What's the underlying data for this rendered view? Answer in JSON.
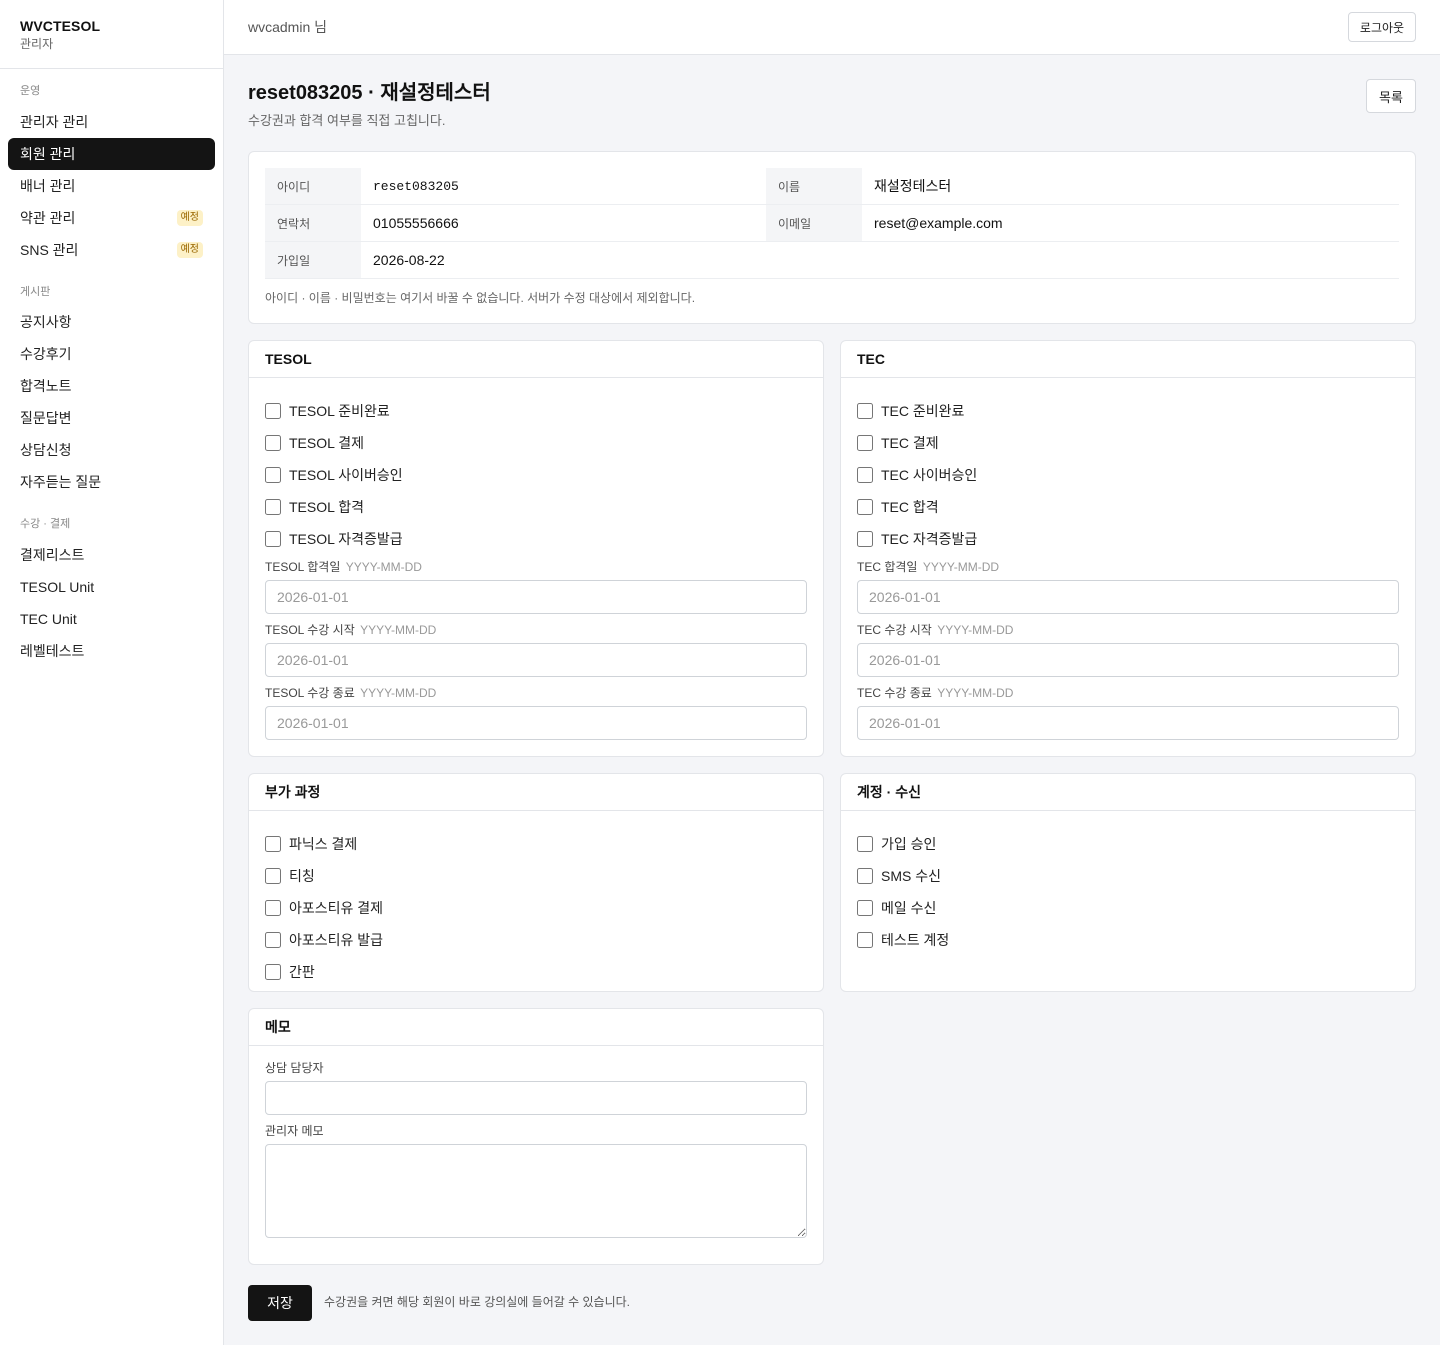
{
  "brand": {
    "title": "WVCTESOL",
    "subtitle": "관리자"
  },
  "sidebar": {
    "sections": [
      {
        "heading": "운영",
        "items": [
          {
            "label": "관리자 관리"
          },
          {
            "label": "회원 관리",
            "active": true
          },
          {
            "label": "배너 관리"
          },
          {
            "label": "약관 관리",
            "badge": "예정"
          },
          {
            "label": "SNS 관리",
            "badge": "예정"
          }
        ]
      },
      {
        "heading": "게시판",
        "items": [
          {
            "label": "공지사항"
          },
          {
            "label": "수강후기"
          },
          {
            "label": "합격노트"
          },
          {
            "label": "질문답변"
          },
          {
            "label": "상담신청"
          },
          {
            "label": "자주듣는 질문"
          }
        ]
      },
      {
        "heading": "수강 · 결제",
        "items": [
          {
            "label": "결제리스트"
          },
          {
            "label": "TESOL Unit"
          },
          {
            "label": "TEC Unit"
          },
          {
            "label": "레벨테스트"
          }
        ]
      }
    ]
  },
  "topbar": {
    "user": "wvcadmin 님",
    "logout_label": "로그아웃"
  },
  "page": {
    "title": "reset083205 · 재설정테스터",
    "subtitle": "수강권과 합격 여부를 직접 고칩니다.",
    "list_button": "목록"
  },
  "info": {
    "id_label": "아이디",
    "id_value": "reset083205",
    "name_label": "이름",
    "name_value": "재설정테스터",
    "phone_label": "연락처",
    "phone_value": "01055556666",
    "email_label": "이메일",
    "email_value": "reset@example.com",
    "joined_label": "가입일",
    "joined_value": "2026-08-22",
    "note": "아이디 · 이름 · 비밀번호는 여기서 바꿀 수 없습니다. 서버가 수정 대상에서 제외합니다."
  },
  "tesol": {
    "title": "TESOL",
    "checks": [
      "TESOL 준비완료",
      "TESOL 결제",
      "TESOL 사이버승인",
      "TESOL 합격",
      "TESOL 자격증발급"
    ],
    "fields": [
      {
        "label": "TESOL 합격일",
        "hint": "YYYY-MM-DD",
        "placeholder": "2026-01-01"
      },
      {
        "label": "TESOL 수강 시작",
        "hint": "YYYY-MM-DD",
        "placeholder": "2026-01-01"
      },
      {
        "label": "TESOL 수강 종료",
        "hint": "YYYY-MM-DD",
        "placeholder": "2026-01-01"
      }
    ]
  },
  "tec": {
    "title": "TEC",
    "checks": [
      "TEC 준비완료",
      "TEC 결제",
      "TEC 사이버승인",
      "TEC 합격",
      "TEC 자격증발급"
    ],
    "fields": [
      {
        "label": "TEC 합격일",
        "hint": "YYYY-MM-DD",
        "placeholder": "2026-01-01"
      },
      {
        "label": "TEC 수강 시작",
        "hint": "YYYY-MM-DD",
        "placeholder": "2026-01-01"
      },
      {
        "label": "TEC 수강 종료",
        "hint": "YYYY-MM-DD",
        "placeholder": "2026-01-01"
      }
    ]
  },
  "extra": {
    "title": "부가 과정",
    "checks": [
      "파닉스 결제",
      "티칭",
      "아포스티유 결제",
      "아포스티유 발급",
      "간판"
    ]
  },
  "account": {
    "title": "계정 · 수신",
    "checks": [
      "가입 승인",
      "SMS 수신",
      "메일 수신",
      "테스트 계정"
    ]
  },
  "memo": {
    "title": "메모",
    "counselor_label": "상담 담당자",
    "admin_memo_label": "관리자 메모"
  },
  "footer": {
    "save_label": "저장",
    "note": "수강권을 켜면 해당 회원이 바로 강의실에 들어갈 수 있습니다."
  }
}
